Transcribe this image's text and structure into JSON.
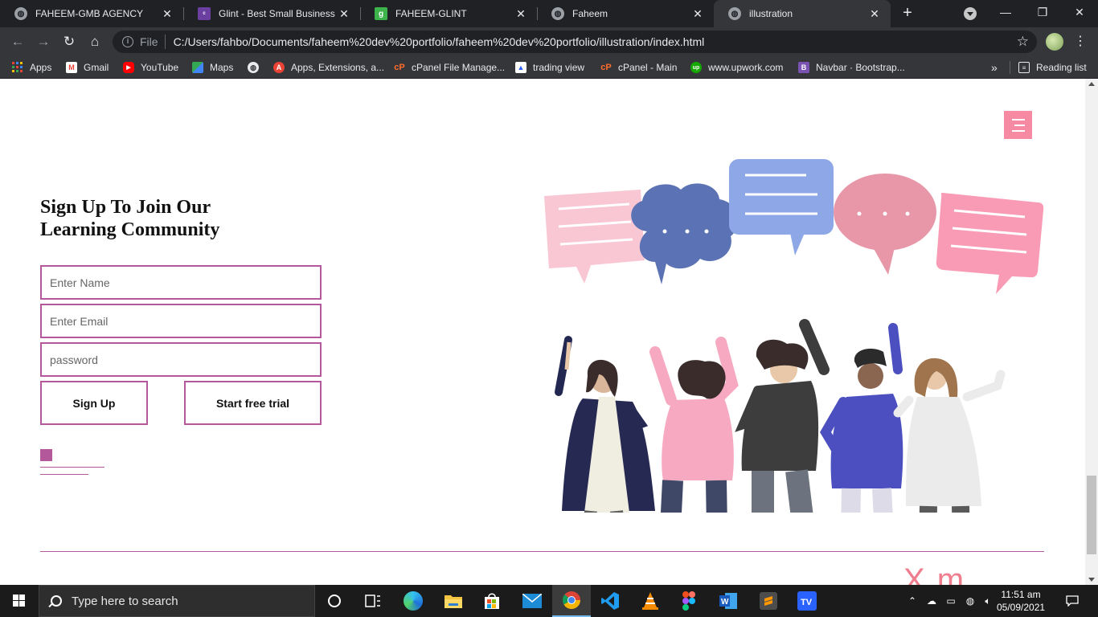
{
  "browser": {
    "tabs": [
      {
        "title": "FAHEEM-GMB AGENCY",
        "icon": "globe-icon",
        "active": false
      },
      {
        "title": "Glint - Best Small Business W",
        "icon": "colorlib-icon",
        "active": false
      },
      {
        "title": "FAHEEM-GLINT",
        "icon": "g-icon",
        "active": false
      },
      {
        "title": "Faheem",
        "icon": "globe-icon",
        "active": false
      },
      {
        "title": "illustration",
        "icon": "globe-icon",
        "active": true
      }
    ],
    "new_tab": "+",
    "address": {
      "scheme_label": "File",
      "url": "C:/Users/fahbo/Documents/faheem%20dev%20portfolio/faheem%20dev%20portfolio/illustration/index.html"
    },
    "bookmarks": [
      {
        "label": "Apps",
        "icon": "apps-grid-icon"
      },
      {
        "label": "Gmail",
        "icon": "gmail-icon"
      },
      {
        "label": "YouTube",
        "icon": "youtube-icon"
      },
      {
        "label": "Maps",
        "icon": "maps-icon"
      },
      {
        "label": "",
        "icon": "globe-icon"
      },
      {
        "label": "Apps, Extensions, a...",
        "icon": "extension-icon"
      },
      {
        "label": "cPanel File Manage...",
        "icon": "cpanel-icon"
      },
      {
        "label": "trading view",
        "icon": "tradingview-icon"
      },
      {
        "label": "cPanel - Main",
        "icon": "cpanel-icon"
      },
      {
        "label": "www.upwork.com",
        "icon": "upwork-icon"
      },
      {
        "label": "Navbar · Bootstrap...",
        "icon": "bootstrap-icon"
      }
    ],
    "bookmarks_more": "»",
    "reading_list": "Reading list"
  },
  "page": {
    "heading_line1": "Sign Up To Join Our",
    "heading_line2": "Learning Community",
    "form": {
      "name_placeholder": "Enter Name",
      "email_placeholder": "Enter Email",
      "password_placeholder": "password",
      "signup_label": "Sign Up",
      "trial_label": "Start free trial"
    },
    "logo_peek": "X    m",
    "colors": {
      "accent": "#b3589a",
      "menu": "#f58aa2",
      "logo": "#f07d8d"
    }
  },
  "taskbar": {
    "search_placeholder": "Type here to search",
    "apps": [
      "task-view-icon",
      "widgets-icon",
      "edge-icon",
      "file-explorer-icon",
      "store-icon",
      "mail-icon",
      "chrome-icon",
      "vscode-icon",
      "vlc-icon",
      "figma-icon",
      "word-icon",
      "sublime-icon",
      "tradingview-icon"
    ],
    "time": "11:51 am",
    "date": "05/09/2021"
  }
}
